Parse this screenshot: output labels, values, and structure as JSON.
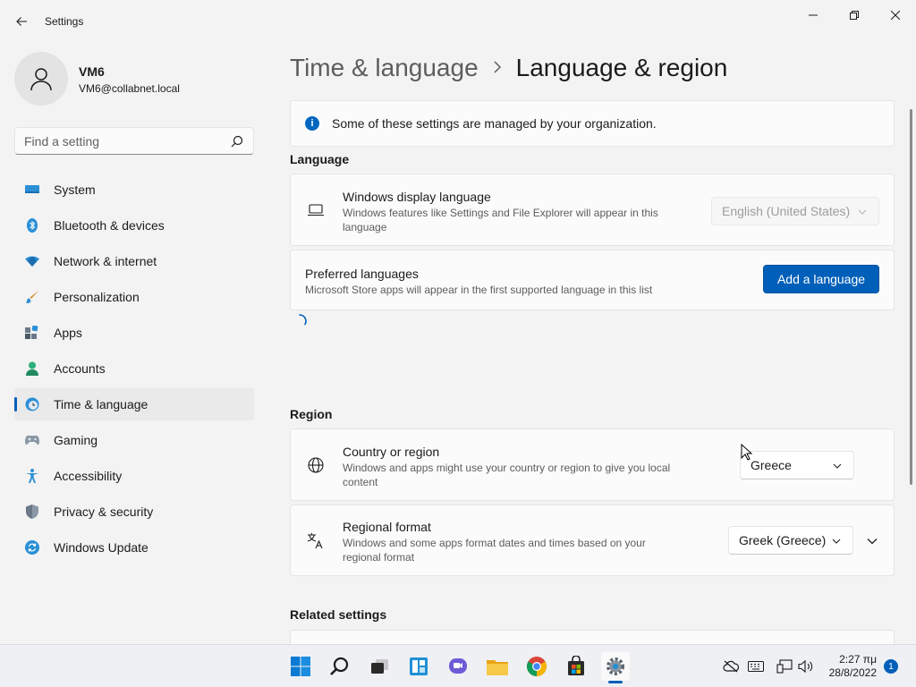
{
  "window": {
    "title": "Settings",
    "back_icon": "back-arrow-icon",
    "controls": [
      "minimize-icon",
      "maximize-icon",
      "close-icon"
    ]
  },
  "profile": {
    "name": "VM6",
    "email": "VM6@collabnet.local",
    "avatar_icon": "person-icon"
  },
  "search": {
    "placeholder": "Find a setting",
    "icon": "search-icon"
  },
  "nav": {
    "active": "Time & language",
    "items": [
      {
        "label": "System",
        "icon": "monitor-icon"
      },
      {
        "label": "Bluetooth & devices",
        "icon": "bluetooth-icon"
      },
      {
        "label": "Network & internet",
        "icon": "wifi-icon"
      },
      {
        "label": "Personalization",
        "icon": "brush-icon"
      },
      {
        "label": "Apps",
        "icon": "apps-icon"
      },
      {
        "label": "Accounts",
        "icon": "account-icon"
      },
      {
        "label": "Time & language",
        "icon": "clock-globe-icon"
      },
      {
        "label": "Gaming",
        "icon": "gamepad-icon"
      },
      {
        "label": "Accessibility",
        "icon": "accessibility-icon"
      },
      {
        "label": "Privacy & security",
        "icon": "shield-icon"
      },
      {
        "label": "Windows Update",
        "icon": "update-icon"
      }
    ]
  },
  "breadcrumb": {
    "parent": "Time & language",
    "separator": ">",
    "current": "Language & region"
  },
  "info_bar": {
    "text": "Some of these settings are managed by your organization.",
    "icon": "info-icon"
  },
  "language": {
    "section_title": "Language",
    "display_language": {
      "title": "Windows display language",
      "description": "Windows features like Settings and File Explorer will appear in this language",
      "value": "English (United States)",
      "disabled": true,
      "icon": "laptop-icon"
    },
    "preferred_languages": {
      "title": "Preferred languages",
      "description": "Microsoft Store apps will appear in the first supported language in this list",
      "button_label": "Add a language"
    }
  },
  "region": {
    "section_title": "Region",
    "country": {
      "title": "Country or region",
      "description": "Windows and apps might use your country or region to give you local content",
      "value": "Greece",
      "icon": "globe-icon"
    },
    "format": {
      "title": "Regional format",
      "description": "Windows and some apps format dates and times based on your regional format",
      "value": "Greek (Greece)",
      "icon": "language-format-icon"
    }
  },
  "related": {
    "section_title": "Related settings"
  },
  "taskbar": {
    "apps": [
      "start-icon",
      "search-icon",
      "task-view-icon",
      "widgets-icon",
      "chat-icon",
      "file-explorer-icon",
      "chrome-icon",
      "store-icon",
      "settings-icon"
    ],
    "active_app": "settings-icon",
    "tray": [
      "cloud-offline-icon",
      "keyboard-icon",
      "network-icon",
      "volume-icon"
    ],
    "time": "2:27 πμ",
    "date": "28/8/2022",
    "notifications": "1"
  },
  "colors": {
    "accent": "#005fb8",
    "background": "#f3f3f3",
    "card": "#fbfbfb"
  }
}
